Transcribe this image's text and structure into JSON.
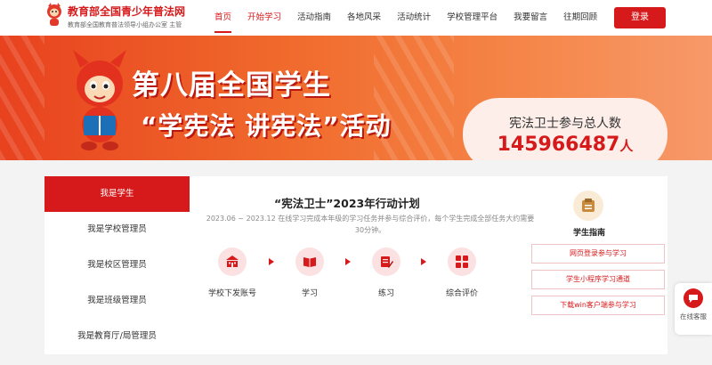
{
  "header": {
    "site_title": "教育部全国青少年普法网",
    "site_subtitle": "教育部全国教育普法领导小组办公室 主管",
    "nav": [
      {
        "label": "首页",
        "state": "active"
      },
      {
        "label": "开始学习",
        "state": "highlight"
      },
      {
        "label": "活动指南",
        "state": ""
      },
      {
        "label": "各地风采",
        "state": ""
      },
      {
        "label": "活动统计",
        "state": ""
      },
      {
        "label": "学校管理平台",
        "state": ""
      },
      {
        "label": "我要留言",
        "state": ""
      },
      {
        "label": "往期回顾",
        "state": ""
      }
    ],
    "login_label": "登录"
  },
  "banner": {
    "title_line1": "第八届全国学生",
    "title_line2": "“学宪法 讲宪法”活动",
    "stat_label": "宪法卫士参与总人数",
    "stat_value": "145966487",
    "stat_unit": "人"
  },
  "sidebar": {
    "items": [
      {
        "label": "我是学生",
        "active": true
      },
      {
        "label": "我是学校管理员",
        "active": false
      },
      {
        "label": "我是校区管理员",
        "active": false
      },
      {
        "label": "我是班级管理员",
        "active": false
      },
      {
        "label": "我是教育厅/局管理员",
        "active": false
      }
    ]
  },
  "plan": {
    "title": "“宪法卫士”2023年行动计划",
    "description": "2023.06 ~ 2023.12 在线学习完成本年级的学习任务并参与综合评价，每个学生完成全部任务大约需要30分钟。",
    "steps": [
      {
        "label": "学校下发账号",
        "icon": "school-icon"
      },
      {
        "label": "学习",
        "icon": "book-icon"
      },
      {
        "label": "练习",
        "icon": "pencil-icon"
      },
      {
        "label": "综合评价",
        "icon": "grid-icon"
      }
    ]
  },
  "guide": {
    "label": "学生指南",
    "icon": "guide-icon",
    "links": [
      "网页登录参与学习",
      "学生小程序学习通道",
      "下载win客户端参与学习"
    ]
  },
  "float_service": {
    "label": "在线客服",
    "icon": "chat-icon"
  },
  "colors": {
    "brand_red": "#d6191b",
    "banner_orange": "#f06a2c",
    "stat_card_bg": "#fdeee9"
  }
}
